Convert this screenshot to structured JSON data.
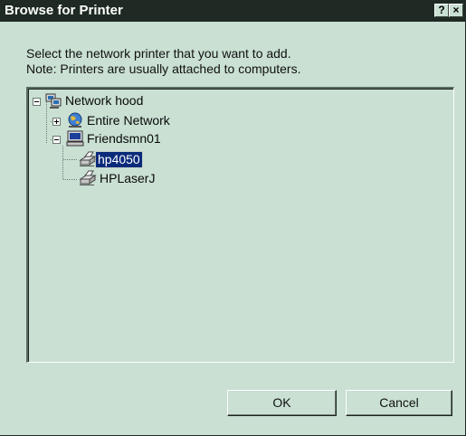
{
  "window": {
    "title": "Browse for Printer",
    "help_label": "?",
    "close_label": "×"
  },
  "instructions": {
    "line1": "Select the network printer that you want to add.",
    "line2": "Note: Printers are usually attached to computers."
  },
  "tree": {
    "nodes": [
      {
        "label": "Network hood",
        "icon": "network-neighborhood-icon",
        "expander": "minus"
      },
      {
        "label": "Entire Network",
        "icon": "globe-icon",
        "expander": "plus"
      },
      {
        "label": "Friendsmn01",
        "icon": "computer-icon",
        "expander": "minus"
      },
      {
        "label": "hp4050",
        "icon": "printer-icon",
        "selected": true
      },
      {
        "label": "HPLaserJ",
        "icon": "printer-icon"
      }
    ]
  },
  "buttons": {
    "ok": "OK",
    "cancel": "Cancel"
  },
  "colors": {
    "face": "#c9e0d3",
    "titlebar": "#1e2a23",
    "selection": "#0a2a7a"
  }
}
